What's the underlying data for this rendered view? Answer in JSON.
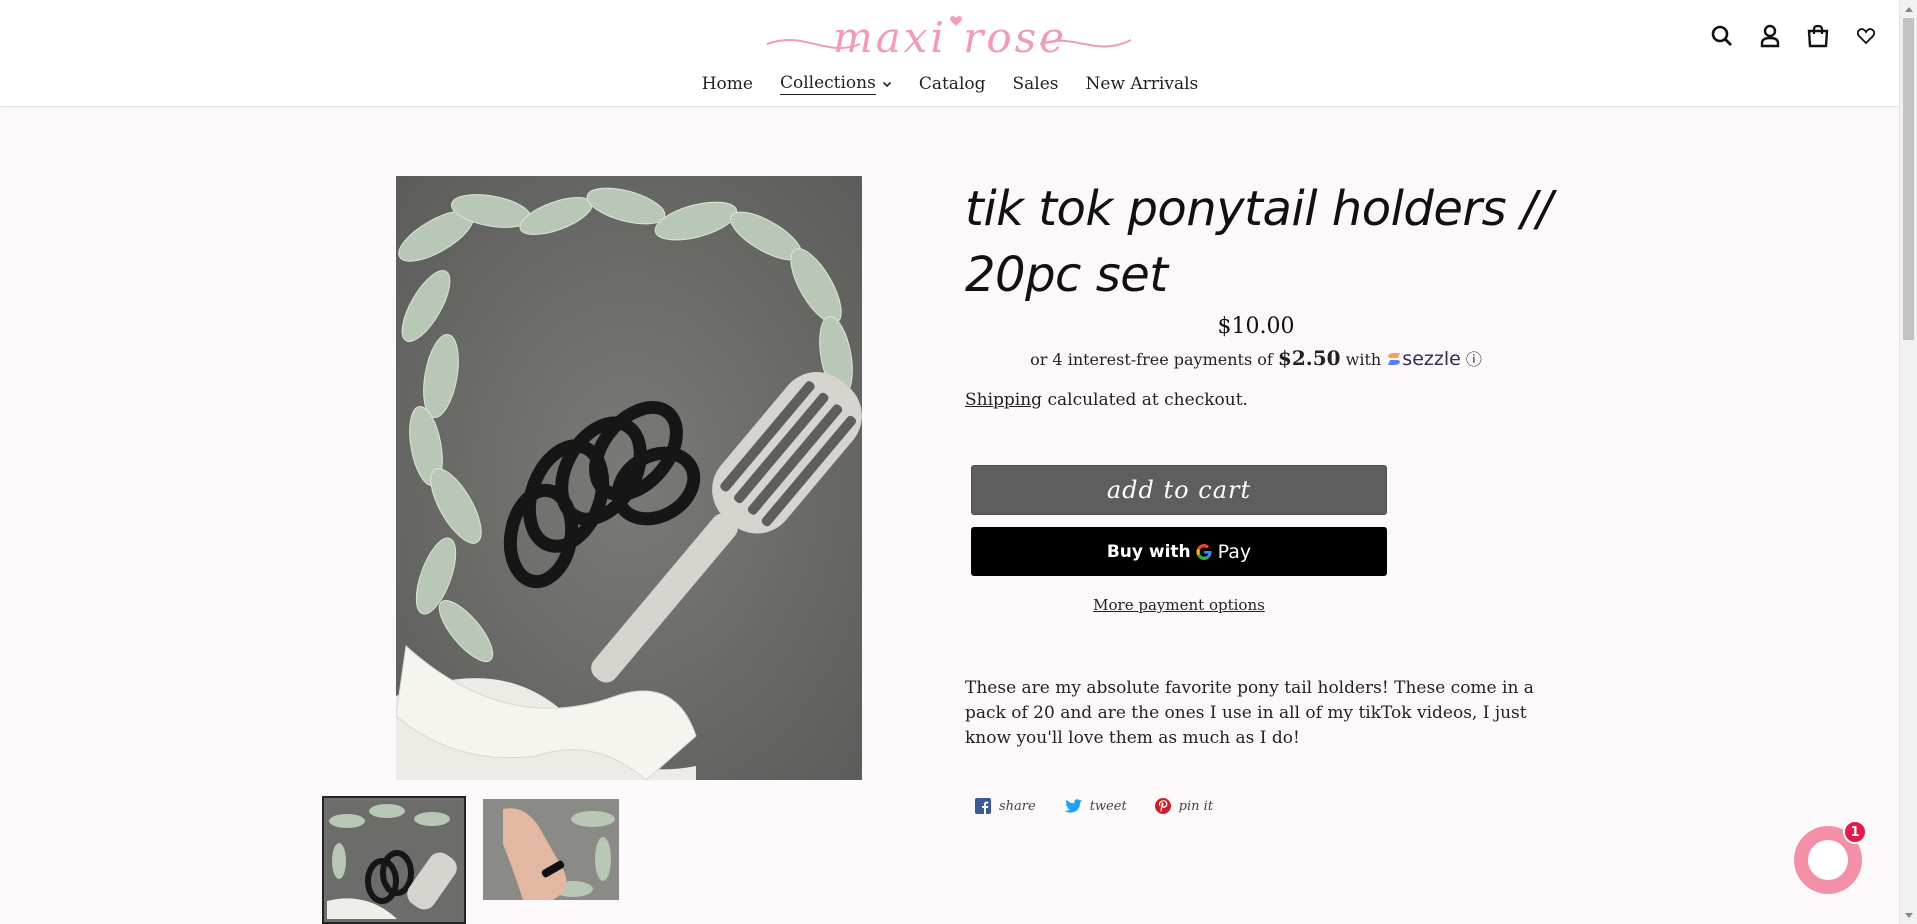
{
  "header": {
    "logo_text": "maxi rose",
    "nav": [
      {
        "label": "Home"
      },
      {
        "label": "Collections"
      },
      {
        "label": "Catalog"
      },
      {
        "label": "Sales"
      },
      {
        "label": "New Arrivals"
      }
    ],
    "icons": [
      "search-icon",
      "account-icon",
      "cart-icon",
      "wishlist-heart-icon"
    ]
  },
  "product": {
    "title": "tik tok ponytail holders // 20pc set",
    "price": "$10.00",
    "sezzle": {
      "prefix": "or 4 interest-free payments of",
      "amount": "$2.50",
      "with": "with",
      "brand": "sezzle",
      "info_glyph": "ⓘ"
    },
    "shipping": {
      "link": "Shipping",
      "text": " calculated at checkout."
    },
    "add_to_cart": "add to cart",
    "gpay": {
      "buy_with": "Buy with",
      "pay": "Pay"
    },
    "more_payment": "More payment options",
    "description": "These are my absolute favorite pony tail holders! These come in a pack of 20 and are the ones I use in all of my tikTok videos, I just know you'll love them as much as I do!",
    "share": [
      {
        "icon": "facebook-icon",
        "label": "share"
      },
      {
        "icon": "twitter-icon",
        "label": "tweet"
      },
      {
        "icon": "pinterest-icon",
        "label": "pin it"
      }
    ]
  },
  "chat": {
    "badge": "1"
  },
  "colors": {
    "logo_pink": "#f29bb7",
    "cart_button": "#5e5e5e",
    "gpay_button": "#000000",
    "chat_pink": "#f390a8",
    "badge_red": "#e5194a",
    "facebook_blue": "#3b5998",
    "twitter_blue": "#1da1f2",
    "pinterest_red": "#cb2027"
  }
}
